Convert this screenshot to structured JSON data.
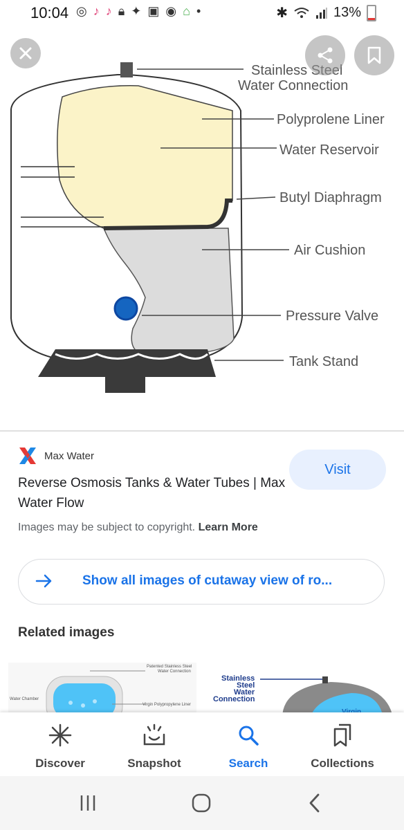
{
  "status_bar": {
    "time": "10:04",
    "battery_percent": "13%",
    "left_icons": [
      "whatsapp-status-icon",
      "tiktok-icon",
      "tiktok-icon",
      "lock-icon",
      "twitter-icon",
      "video-icon",
      "app-icon",
      "google-home-icon",
      "dot-icon"
    ],
    "right_icons": [
      "bluetooth-icon",
      "wifi-icon",
      "signal-icon",
      "battery-icon"
    ]
  },
  "hero_image": {
    "labels": [
      "Stainless Steel",
      "Water Connection",
      "Polyprolene Liner",
      "Water Reservoir",
      "Butyl Diaphragm",
      "Air Cushion",
      "Pressure Valve",
      "Tank Stand"
    ],
    "colors": {
      "reservoir": "#fbf3c8",
      "air_cushion": "#dcdcdc",
      "valve": "#1565c0",
      "stand": "#3a3a3a"
    }
  },
  "result": {
    "source_name": "Max Water",
    "title": "Reverse Osmosis Tanks & Water Tubes | Max Water Flow",
    "visit_label": "Visit",
    "copyright_text": "Images may be subject to copyright.",
    "learn_more_label": "Learn More"
  },
  "show_all": {
    "label": "Show all images of cutaway view of ro..."
  },
  "related": {
    "title": "Related images",
    "thumb1_labels": [
      "Patented Stainless Steel",
      "Water Connection",
      "Water Chamber",
      "Virgin Polypropylene Liner"
    ],
    "thumb2_labels": [
      "Stainless",
      "Steel",
      "Water",
      "Connection",
      "Virgin"
    ]
  },
  "bottom_nav": {
    "items": [
      {
        "label": "Discover",
        "icon": "asterisk-icon"
      },
      {
        "label": "Snapshot",
        "icon": "snapshot-icon"
      },
      {
        "label": "Search",
        "icon": "search-icon"
      },
      {
        "label": "Collections",
        "icon": "collections-icon"
      }
    ],
    "active": "Search",
    "active_color": "#1a73e8"
  },
  "system_nav": {
    "icons": [
      "recent-apps-icon",
      "home-icon",
      "back-icon"
    ]
  }
}
